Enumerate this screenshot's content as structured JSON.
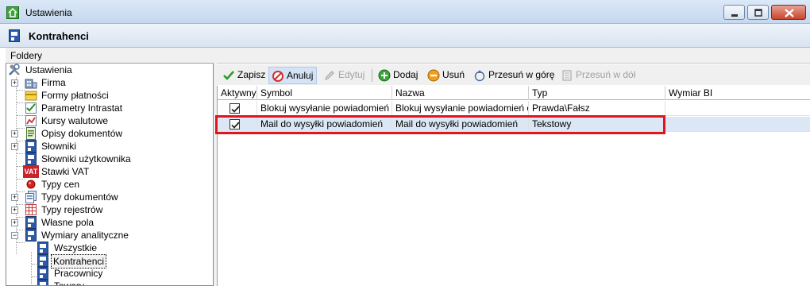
{
  "window": {
    "title": "Ustawienia"
  },
  "header": {
    "title": "Kontrahenci"
  },
  "folders": {
    "title": "Foldery",
    "root": "Ustawienia",
    "items": [
      "Firma",
      "Formy płatności",
      "Parametry Intrastat",
      "Kursy walutowe",
      "Opisy dokumentów",
      "Słowniki",
      "Słowniki użytkownika",
      "Stawki VAT",
      "Typy cen",
      "Typy dokumentów",
      "Typy rejestrów",
      "Własne pola",
      "Wymiary analityczne"
    ],
    "subitems": [
      "Wszystkie",
      "Kontrahenci",
      "Pracownicy",
      "Towary"
    ],
    "vat_badge": "VAT"
  },
  "toolbar": {
    "save": "Zapisz",
    "cancel": "Anuluj",
    "edit": "Edytuj",
    "add": "Dodaj",
    "delete": "Usuń",
    "move_up": "Przesuń w górę",
    "move_down": "Przesuń w dół"
  },
  "grid": {
    "columns": [
      "Aktywny",
      "Symbol",
      "Nazwa",
      "Typ",
      "Wymiar BI"
    ],
    "rows": [
      {
        "active": true,
        "symbol": "Blokuj wysyłanie powiadomień o...",
        "name": "Blokuj wysyłanie powiadomień o...",
        "type": "Prawda\\Fałsz",
        "bi": ""
      },
      {
        "active": true,
        "symbol": "Mail do wysyłki powiadomień",
        "name": "Mail do wysyłki powiadomień",
        "type": "Tekstowy",
        "bi": ""
      }
    ]
  },
  "colors": {
    "highlight": "#e0161c",
    "selected_row": "#dbe7f4"
  }
}
